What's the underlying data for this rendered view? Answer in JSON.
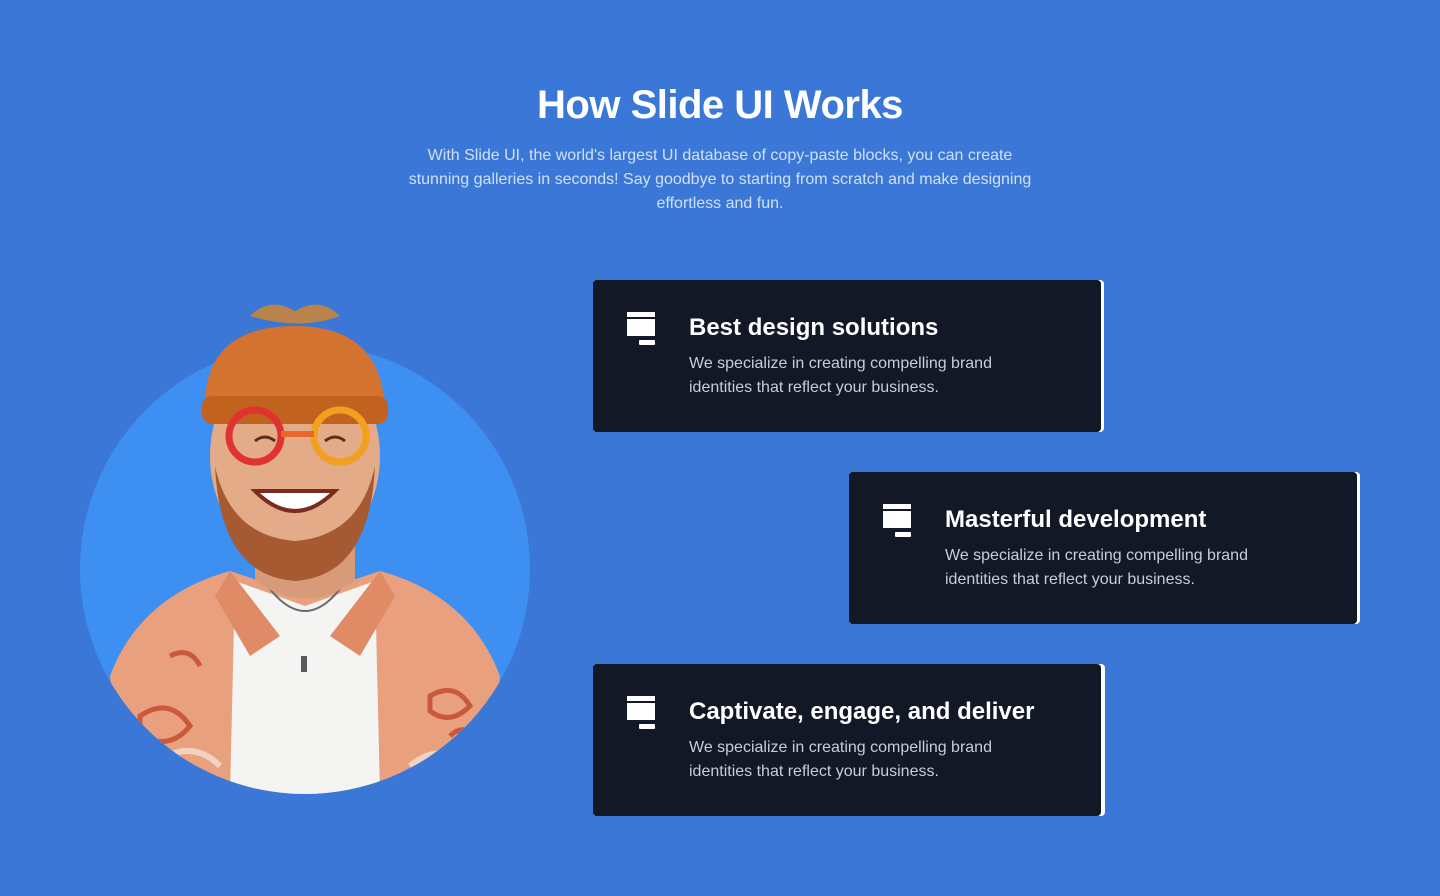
{
  "section": {
    "title": "How Slide UI Works",
    "subtitle": "With Slide UI, the world's largest UI database of copy-paste blocks, you can create stunning galleries in seconds! Say goodbye to starting from scratch and make designing effortless and fun."
  },
  "hero_image": {
    "alt": "Smiling bearded man wearing an orange beanie, colorful glasses and a patterned shirt"
  },
  "features": [
    {
      "icon": "monitor-icon",
      "title": "Best design solutions",
      "description": "We specialize in creating compelling brand identities that reflect your business."
    },
    {
      "icon": "monitor-icon",
      "title": "Masterful development",
      "description": "We specialize in creating compelling brand identities that reflect your business."
    },
    {
      "icon": "monitor-icon",
      "title": "Captivate, engage, and deliver",
      "description": "We specialize in creating compelling brand identities that reflect your business."
    }
  ],
  "colors": {
    "background": "#3b77d6",
    "circle": "#3d90f2",
    "card": "#121826",
    "card_accent": "#ffffff"
  }
}
